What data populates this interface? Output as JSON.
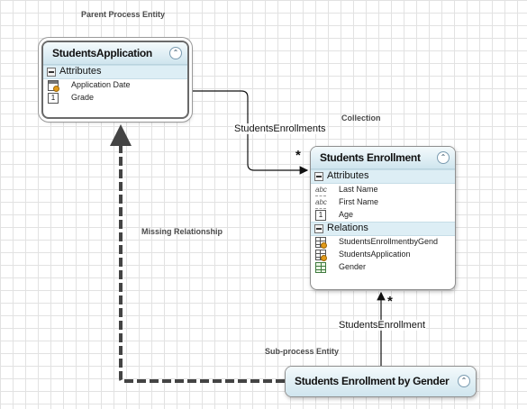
{
  "annotations": {
    "parent_process": "Parent Process Entity",
    "collection": "Collection",
    "missing_relationship": "Missing Relationship",
    "sub_process": "Sub-process Entity"
  },
  "entities": {
    "students_application": {
      "title": "StudentsApplication",
      "attributes_label": "Attributes",
      "attributes": [
        {
          "label": "Application Date",
          "icon": "date-field-icon"
        },
        {
          "label": "Grade",
          "icon": "number-field-icon"
        }
      ]
    },
    "students_enrollment": {
      "title": "Students Enrollment",
      "attributes_label": "Attributes",
      "attributes": [
        {
          "label": "Last Name",
          "icon": "text-field-icon"
        },
        {
          "label": "First Name",
          "icon": "text-field-icon"
        },
        {
          "label": "Age",
          "icon": "number-field-icon"
        }
      ],
      "relations_label": "Relations",
      "relations": [
        {
          "label": "StudentsEnrollmentbyGend",
          "icon": "collection-relation-icon"
        },
        {
          "label": "StudentsApplication",
          "icon": "collection-relation-icon"
        },
        {
          "label": "Gender",
          "icon": "entity-relation-icon"
        }
      ]
    },
    "students_enrollment_by_gender": {
      "title": "Students Enrollment by Gender"
    }
  },
  "edges": {
    "students_enrollments": {
      "label": "StudentsEnrollments",
      "multiplicity": "*"
    },
    "students_enrollment": {
      "label": "StudentsEnrollment",
      "multiplicity": "*"
    }
  },
  "colors": {
    "header_gradient_top": "#f4fafc",
    "header_gradient_bottom": "#cfe5ee",
    "missing_relationship_line": "#444444"
  }
}
